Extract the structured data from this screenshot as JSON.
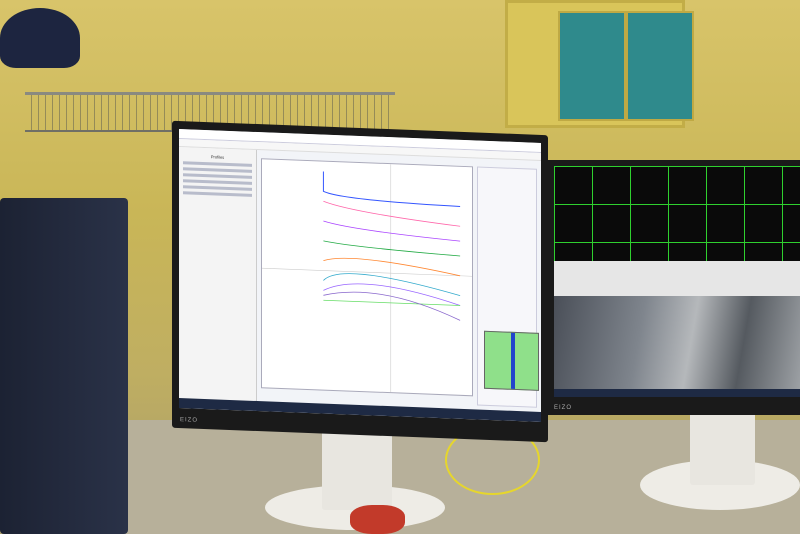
{
  "left_monitor": {
    "brand": "EIZO",
    "sidebar_title": "Profiles",
    "app": "spectral profile viewer"
  },
  "right_monitor": {
    "brand": "EIZO"
  },
  "colors": {
    "wall": "#d8c46a",
    "cabinet": "#2f8a8c",
    "grid": "#2fd02f",
    "histogram": "#8fe08a"
  }
}
